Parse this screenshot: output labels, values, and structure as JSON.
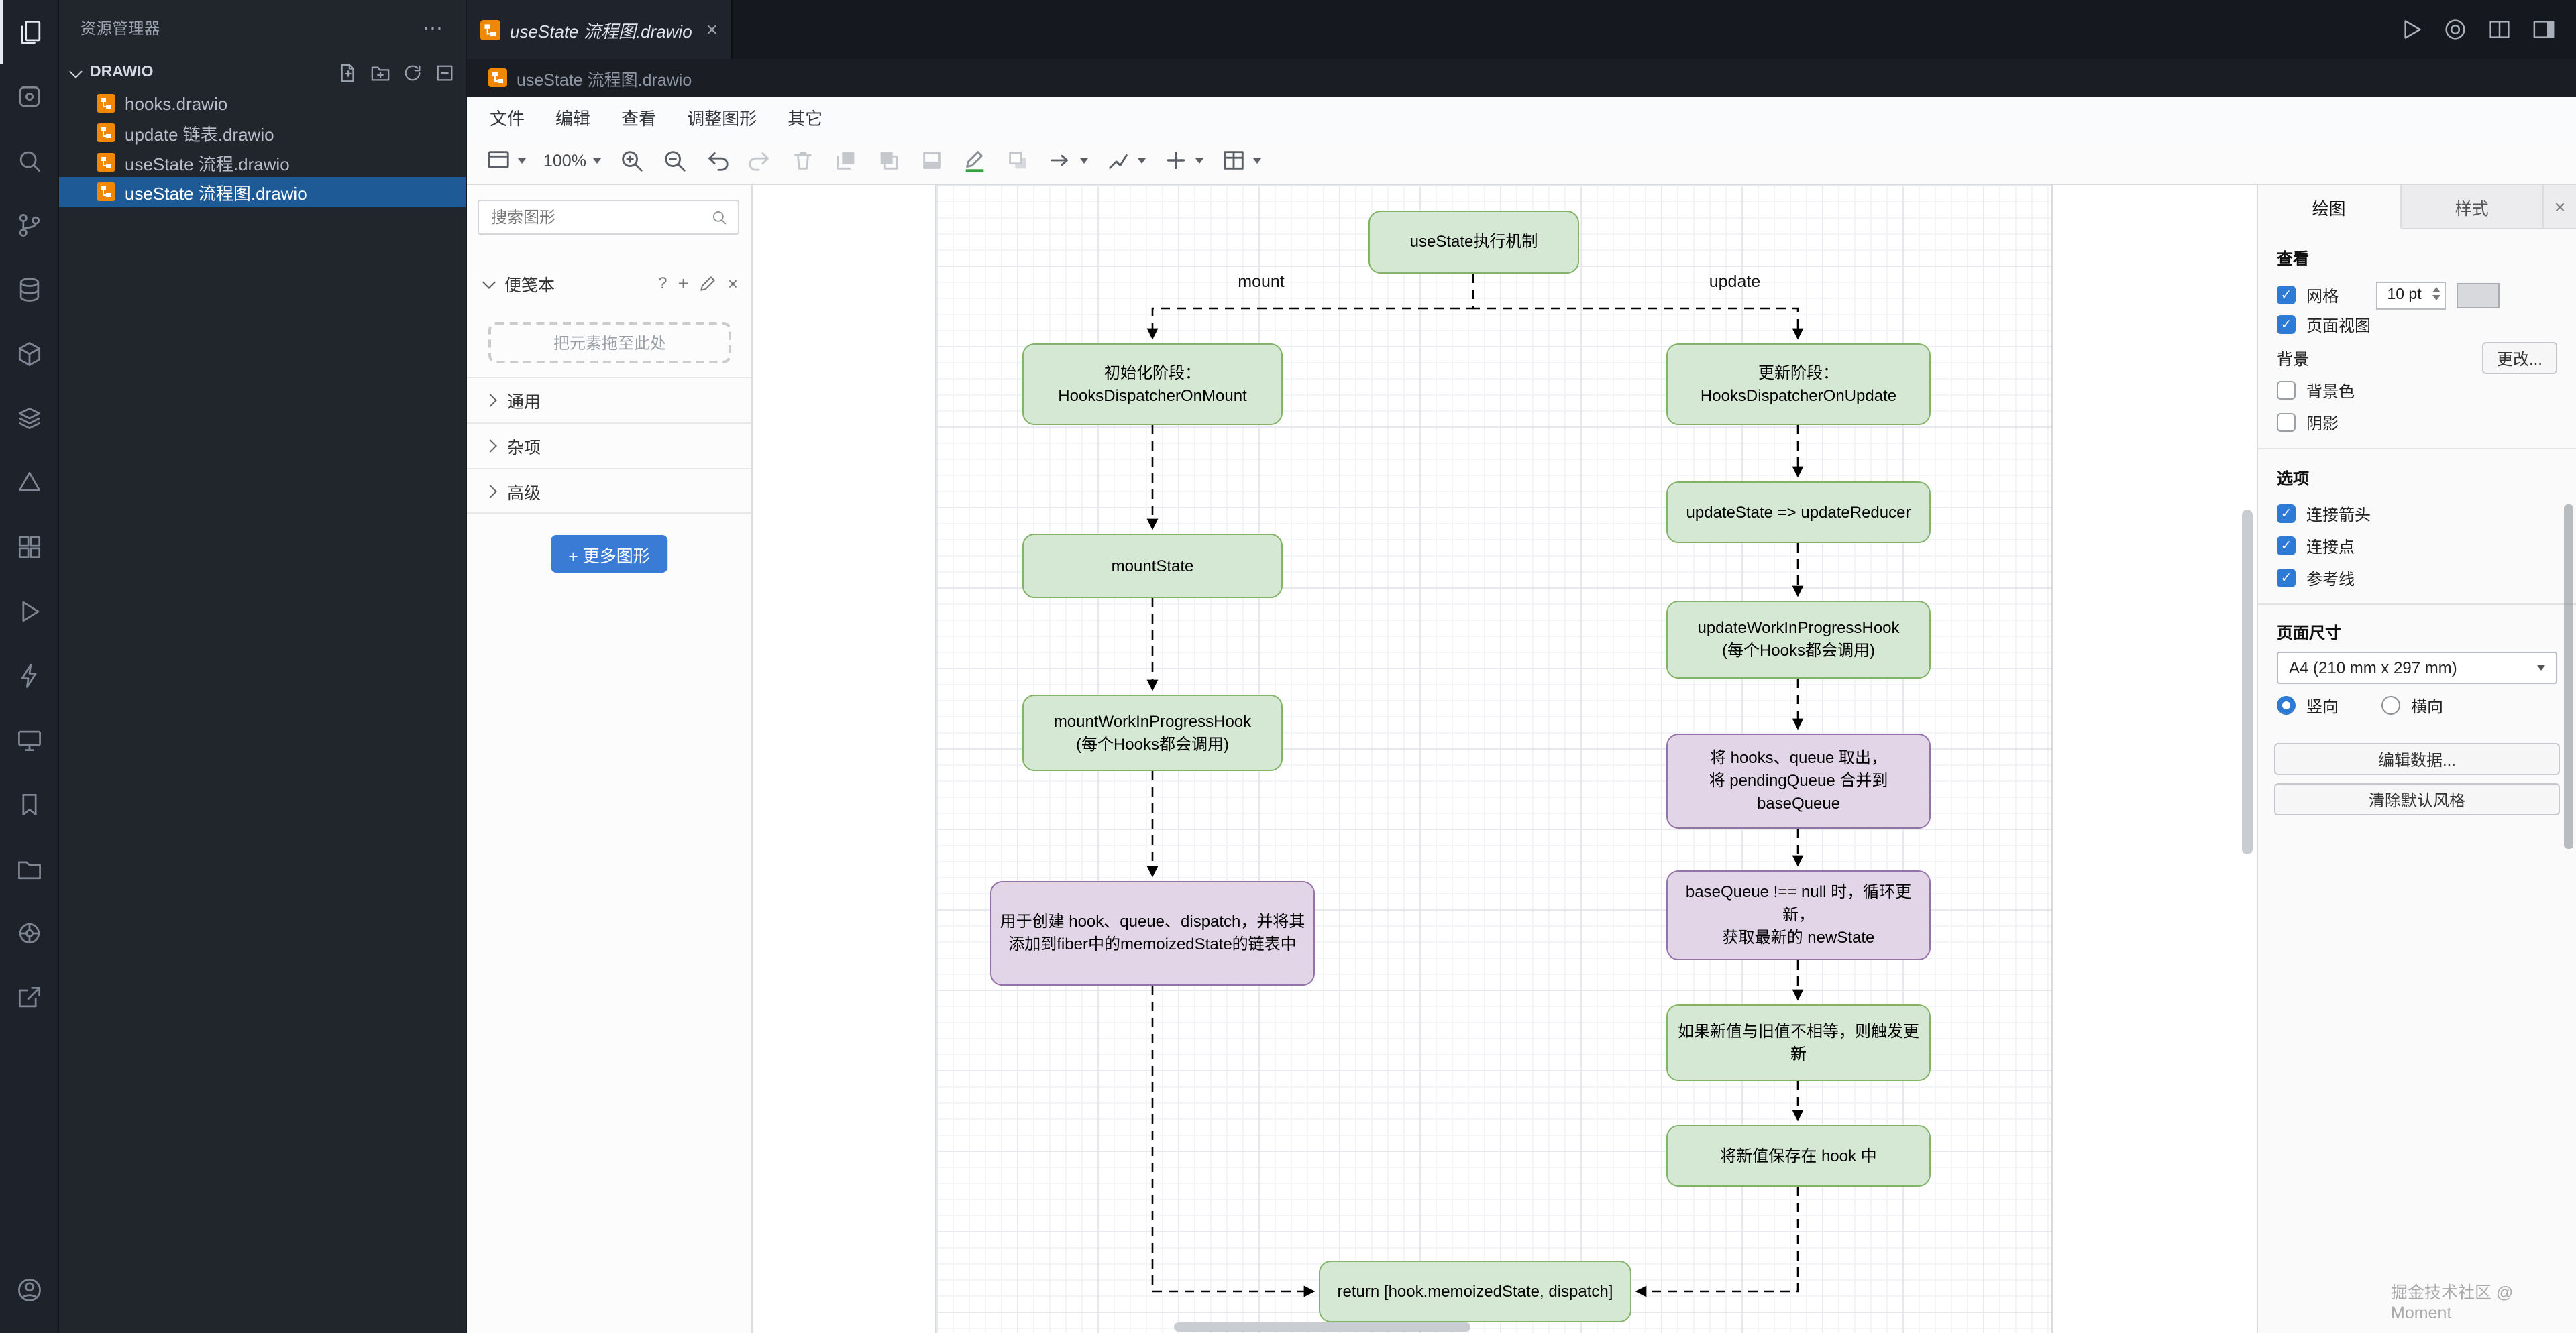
{
  "window": {
    "editor_action_icons": [
      "run-icon",
      "extension-logo-icon",
      "split-editor-icon",
      "customize-layout-icon"
    ]
  },
  "activity_bar": {
    "icons": [
      "explorer-icon",
      "extension-generic-icon",
      "search-icon",
      "source-control-icon",
      "database-icon",
      "container-icon",
      "layers-icon",
      "triangle-tool-icon",
      "extensions-icon",
      "run-debug-icon",
      "thunder-client-icon",
      "remote-explorer-icon",
      "bookmarks-icon",
      "project-folder-icon",
      "kubernetes-wheel-icon",
      "share-icon",
      "account-icon"
    ]
  },
  "sidebar": {
    "header": "资源管理器",
    "section": "DRAWIO",
    "files": [
      "hooks.drawio",
      "update 链表.drawio",
      "useState 流程.drawio",
      "useState 流程图.drawio"
    ],
    "selected_index": 3
  },
  "tab": {
    "title": "useState 流程图.drawio"
  },
  "breadcrumb": "useState 流程图.drawio",
  "menubar": {
    "items": [
      "文件",
      "编辑",
      "查看",
      "调整图形",
      "其它"
    ]
  },
  "toolbar": {
    "zoom": "100%"
  },
  "shapes": {
    "search_placeholder": "搜索图形",
    "scratchpad": "便笺本",
    "dropzone": "把元素拖至此处",
    "sections": [
      "通用",
      "杂项",
      "高级"
    ],
    "more_shapes": "+ 更多图形"
  },
  "canvas": {
    "branch_labels": {
      "left": "mount",
      "right": "update"
    },
    "nodes": [
      {
        "id": "title",
        "label": "useState执行机制",
        "color": "green"
      },
      {
        "id": "mount-stage",
        "label": "初始化阶段：\nHooksDispatcherOnMount",
        "color": "green"
      },
      {
        "id": "mount-state",
        "label": "mountState",
        "color": "green"
      },
      {
        "id": "mount-wip-hook",
        "label": "mountWorkInProgressHook\n(每个Hooks都会调用)",
        "color": "green"
      },
      {
        "id": "mount-create",
        "label": "用于创建 hook、queue、dispatch，并将其\n添加到fiber中的memoizedState的链表中",
        "color": "purple"
      },
      {
        "id": "update-stage",
        "label": "更新阶段：\nHooksDispatcherOnUpdate",
        "color": "green"
      },
      {
        "id": "update-reducer",
        "label": "updateState => updateReducer",
        "color": "green"
      },
      {
        "id": "update-wip-hook",
        "label": "updateWorkInProgressHook\n(每个Hooks都会调用)",
        "color": "green"
      },
      {
        "id": "take-queue",
        "label": "将 hooks、queue 取出，\n将 pendingQueue 合并到 baseQueue",
        "color": "purple"
      },
      {
        "id": "loop-update",
        "label": "baseQueue !== null 时，循环更新，\n获取最新的 newState",
        "color": "purple"
      },
      {
        "id": "compare-trigger",
        "label": "如果新值与旧值不相等，则触发更新",
        "color": "green"
      },
      {
        "id": "save-in-hook",
        "label": "将新值保存在 hook 中",
        "color": "green"
      },
      {
        "id": "return",
        "label": "return [hook.memoizedState, dispatch]",
        "color": "green"
      }
    ]
  },
  "format": {
    "tabs": [
      "绘图",
      "样式"
    ],
    "active_tab": 0,
    "view": {
      "header": "查看",
      "grid": "网格",
      "grid_size": "10 pt",
      "page_view": "页面视图",
      "background": "背景",
      "change": "更改...",
      "background_color": "背景色",
      "shadow": "阴影"
    },
    "options": {
      "header": "选项",
      "items": [
        {
          "label": "连接箭头",
          "checked": true
        },
        {
          "label": "连接点",
          "checked": true
        },
        {
          "label": "参考线",
          "checked": true
        }
      ]
    },
    "paper": {
      "header": "页面尺寸",
      "size": "A4 (210 mm x 297 mm)",
      "portrait": "竖向",
      "landscape": "横向"
    },
    "buttons": {
      "edit_data": "编辑数据...",
      "clear_default": "清除默认风格"
    }
  },
  "watermark": "掘金技术社区 @ Moment",
  "colors": {
    "node_green_fill": "#d5e8d4",
    "node_green_border": "#82b366",
    "node_purple_fill": "#e1d5e7",
    "node_purple_border": "#9673a6",
    "sidebar_selection": "#1d5a96",
    "accent_button": "#3a7bd5",
    "checkbox_blue": "#2e7bd6",
    "drawio_orange": "#f08705"
  }
}
